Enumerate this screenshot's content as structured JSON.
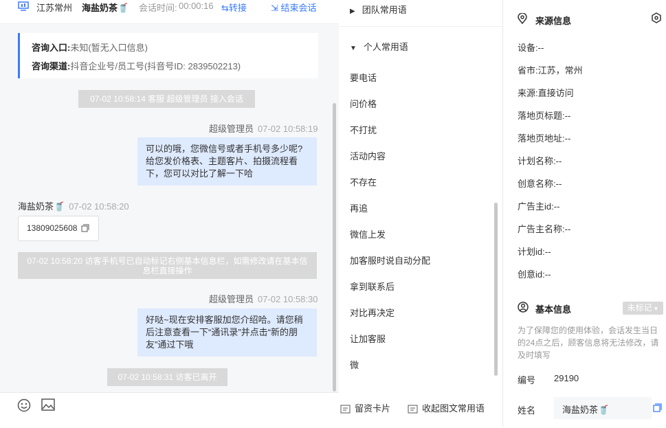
{
  "topbar": {
    "location": "江苏常州",
    "visitor_name": "海盐奶茶🥤",
    "time_label": "会话时间:",
    "time_value": "00:00:16",
    "transfer_label": "转接",
    "end_label": "结束会话"
  },
  "info_card": {
    "entry_label": "咨询入口:",
    "entry_value": "未知(暂无入口信息)",
    "channel_label": "咨询渠道:",
    "channel_value": "抖音企业号/员工号(抖音号ID: 2839502213)"
  },
  "messages": {
    "sys1": "07-02 10:58:14 客服 超级管理员 接入会话",
    "agent1_name": "超级管理员",
    "agent1_time": "07-02 10:58:19",
    "agent1_text": "可以的哦，您微信号或者手机号多少呢?给您发价格表、主题客片、拍摄流程看下，您可以对比了解一下哈",
    "visitor_name": "海盐奶茶🥤",
    "visitor_time": "07-02 10:58:20",
    "visitor_phone": "13809025608",
    "sys2": "07-02 10:58:20 访客手机号已自动标记右侧基本信息栏，如需修改请在基本信息栏直接操作",
    "agent2_name": "超级管理员",
    "agent2_time": "07-02 10:58:30",
    "agent2_text": "好哒~现在安排客服加您介绍哈。请您稍后注意查看一下“通讯录”并点击“新的朋友”通过下哦",
    "sys3": "07-02 10:58:31 访客已离开"
  },
  "phrases": {
    "team_label": "团队常用语",
    "personal_label": "个人常用语",
    "items": [
      "要电话",
      "问价格",
      "不打扰",
      "活动内容",
      "不存在",
      "再追",
      "微信上发",
      "加客服时说自动分配",
      "拿到联系后",
      "对比再决定",
      "让加客服",
      "微"
    ],
    "card_label": "留资卡片",
    "collect_label": "收起图文常用语"
  },
  "source": {
    "title": "来源信息",
    "fields": [
      {
        "label": "设备:",
        "value": "--"
      },
      {
        "label": "省市:",
        "value": "江苏，常州"
      },
      {
        "label": "来源:",
        "value": "直接访问"
      },
      {
        "label": "落地页标题:",
        "value": "--"
      },
      {
        "label": "落地页地址:",
        "value": "--"
      },
      {
        "label": "计划名称:",
        "value": "--"
      },
      {
        "label": "创意名称:",
        "value": "--"
      },
      {
        "label": "广告主id:",
        "value": "--"
      },
      {
        "label": "广告主名称:",
        "value": "--"
      },
      {
        "label": "计划id:",
        "value": "--"
      },
      {
        "label": "创意id:",
        "value": "--"
      }
    ]
  },
  "basic": {
    "title": "基本信息",
    "badge": "未标记",
    "note": "为了保障您的使用体验，会话发生当日的24点之后，顾客信息将无法修改，请及时填写",
    "number_label": "编号",
    "number_value": "29190",
    "name_label": "姓名",
    "name_value": "海盐奶茶🥤"
  },
  "colors": {
    "accent": "#3a7afe",
    "system_bubble": "#d9d9d9",
    "agent_bubble": "#deeafe"
  }
}
